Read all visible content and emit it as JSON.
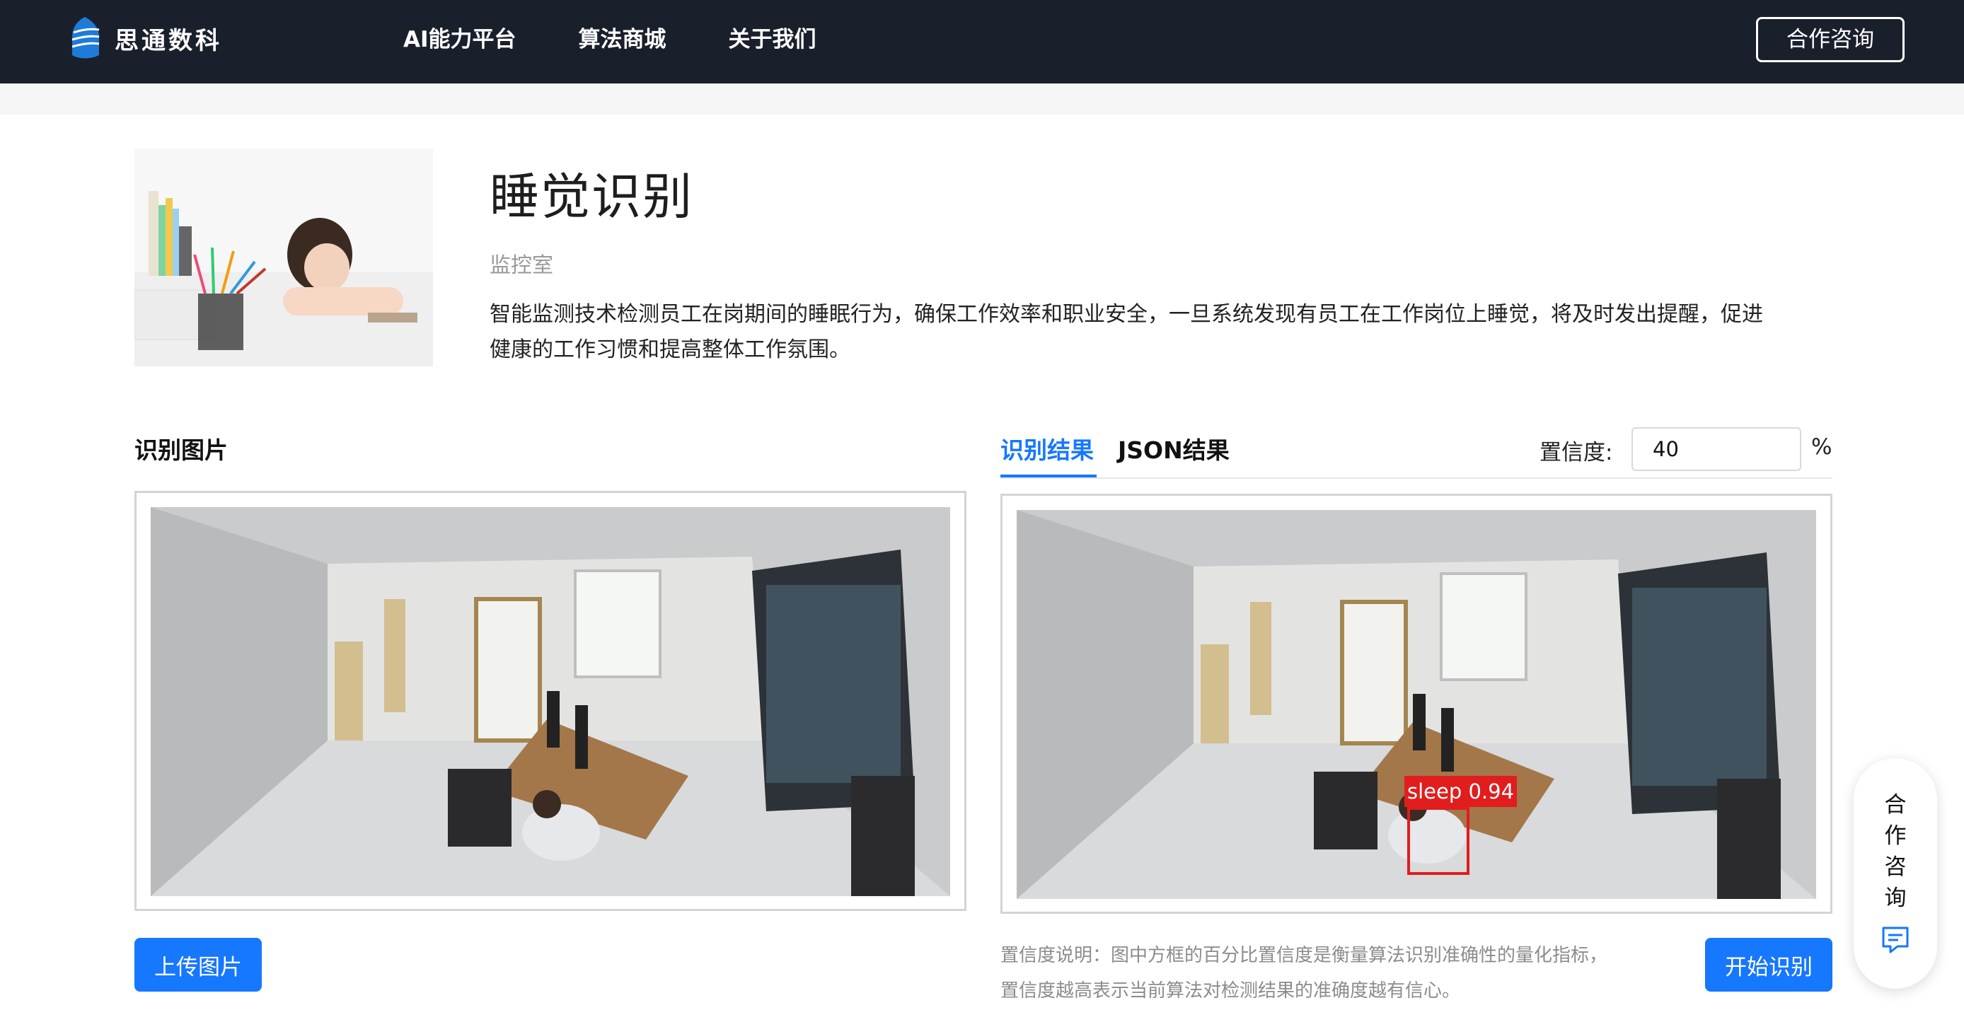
{
  "header": {
    "brand": "思通数科",
    "nav": [
      {
        "label": "AI能力平台"
      },
      {
        "label": "算法商城"
      },
      {
        "label": "关于我们"
      }
    ],
    "consult_button": "合作咨询",
    "bg_color": "#1a1f2c"
  },
  "product": {
    "title": "睡觉识别",
    "tag": "监控室",
    "description": "智能监测技术检测员工在岗期间的睡眠行为，确保工作效率和职业安全，一旦系统发现有员工在工作岗位上睡觉，将及时发出提醒，促进健康的工作习惯和提高整体工作氛围。"
  },
  "input_panel": {
    "label": "识别图片",
    "upload_button": "上传图片"
  },
  "result_panel": {
    "tabs": [
      {
        "label": "识别结果",
        "active": true
      },
      {
        "label": "JSON结果",
        "active": false
      }
    ],
    "confidence_label": "置信度:",
    "confidence_value": "40",
    "confidence_unit": "%",
    "detection": {
      "label": "sleep",
      "score": "0.94",
      "box_color": "#e11d1d"
    },
    "note_line1": "置信度说明：图中方框的百分比置信度是衡量算法识别准确性的量化指标，",
    "note_line2": "置信度越高表示当前算法对检测结果的准确度越有信心。",
    "start_button": "开始识别"
  },
  "float_widget": {
    "chars": [
      "合",
      "作",
      "咨",
      "询"
    ],
    "icon": "chat-icon"
  },
  "colors": {
    "accent": "#1677ff"
  }
}
